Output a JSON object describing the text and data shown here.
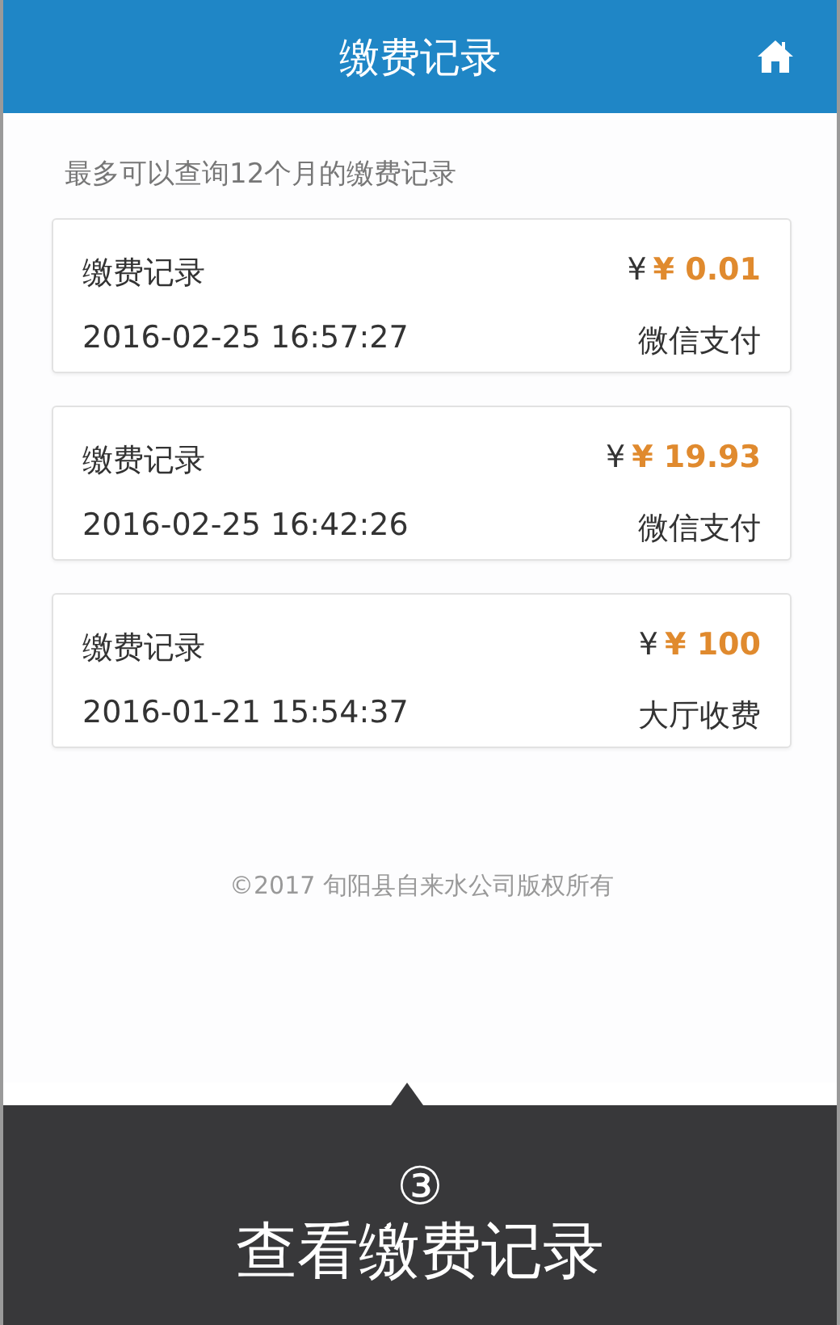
{
  "header": {
    "title": "缴费记录"
  },
  "hint": "最多可以查询12个月的缴费记录",
  "records": [
    {
      "title": "缴费记录",
      "currency": "¥",
      "amount": "¥ 0.01",
      "datetime": "2016-02-25 16:57:27",
      "method": "微信支付"
    },
    {
      "title": "缴费记录",
      "currency": "¥",
      "amount": "¥ 19.93",
      "datetime": "2016-02-25 16:42:26",
      "method": "微信支付"
    },
    {
      "title": "缴费记录",
      "currency": "¥",
      "amount": "¥ 100",
      "datetime": "2016-01-21 15:54:37",
      "method": "大厅收费"
    }
  ],
  "footer": "©2017 旬阳县自来水公司版权所有",
  "caption": {
    "step": "③",
    "text": "查看缴费记录"
  }
}
